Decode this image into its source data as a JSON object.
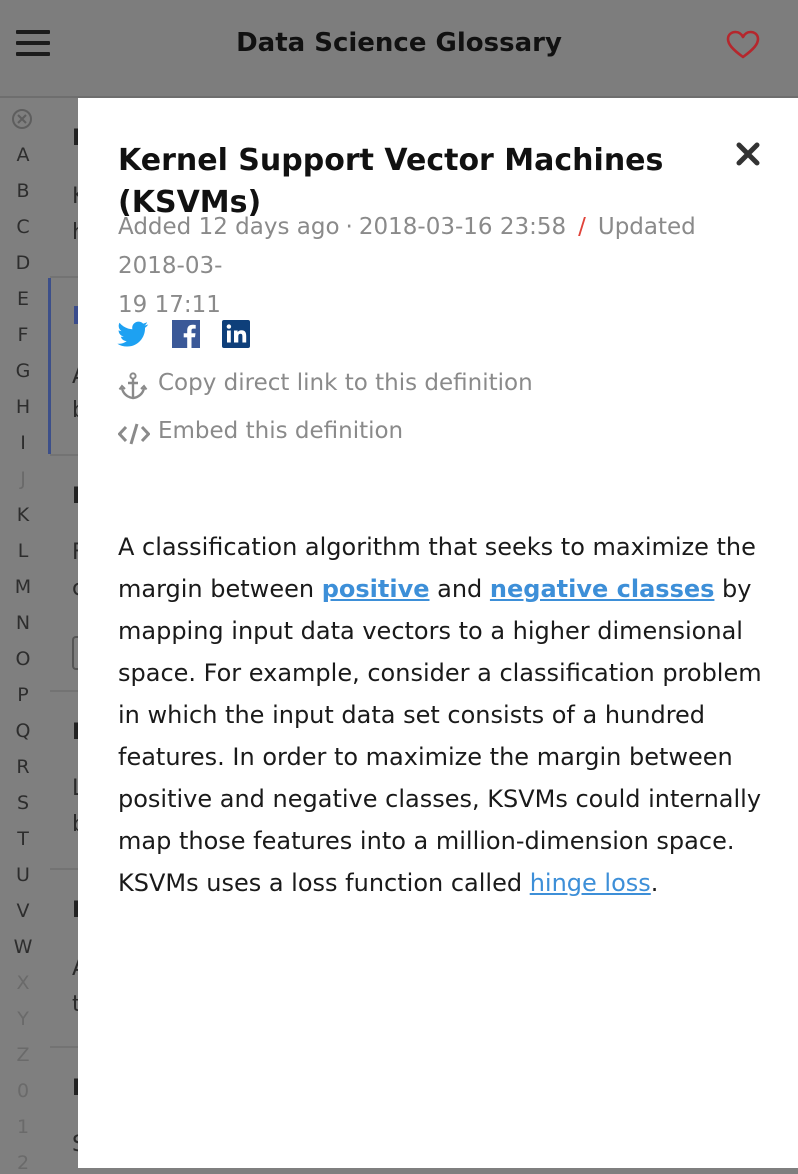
{
  "header": {
    "title": "Data Science Glossary"
  },
  "alphabet": {
    "letters": [
      "A",
      "B",
      "C",
      "D",
      "E",
      "F",
      "G",
      "H",
      "I",
      "J",
      "K",
      "L",
      "M",
      "N",
      "O",
      "P",
      "Q",
      "R",
      "S",
      "T",
      "U",
      "V",
      "W",
      "X",
      "Y",
      "Z",
      "0",
      "1",
      "2"
    ],
    "disabled": [
      "J",
      "X",
      "Y",
      "Z",
      "0",
      "1",
      "2"
    ]
  },
  "background_list": {
    "visible_chars": [
      "I",
      "K",
      "h",
      "A",
      "b",
      "I",
      "F",
      "c",
      "I",
      "L",
      "b",
      "I",
      "A",
      "t",
      "I",
      "S"
    ]
  },
  "modal": {
    "title": "Kernel Support Vector Machines (KSVMs)",
    "added": "Added 12 days ago",
    "added_date": "2018-03-16 23:58",
    "updated_prefix": "Updated 2018-03-",
    "updated_rest": "19 17:11",
    "meta_dot": "·",
    "meta_slash": "/",
    "copy_link_label": "Copy direct link to this definition",
    "embed_label": "Embed this definition",
    "definition": {
      "part1": "A classification algorithm that seeks to maximize the margin between ",
      "link_positive": "positive",
      "part2": " and ",
      "link_negative": "negative classes",
      "part3": " by mapping input data vectors to a higher dimensional space. For example, consider a classification problem in which the input data set consists of a hundred features. In order to maximize the margin between positive and negative classes, KSVMs could internally map those features into a million-dimension space. KSVMs uses a loss function called ",
      "link_hinge": "hinge loss",
      "part4": "."
    }
  },
  "colors": {
    "link": "#3d8fd8",
    "twitter": "#1da1f2",
    "facebook": "#3b5998",
    "linkedin": "#0e3f7a",
    "slash": "#e0433a",
    "heart": "#b5272d"
  }
}
